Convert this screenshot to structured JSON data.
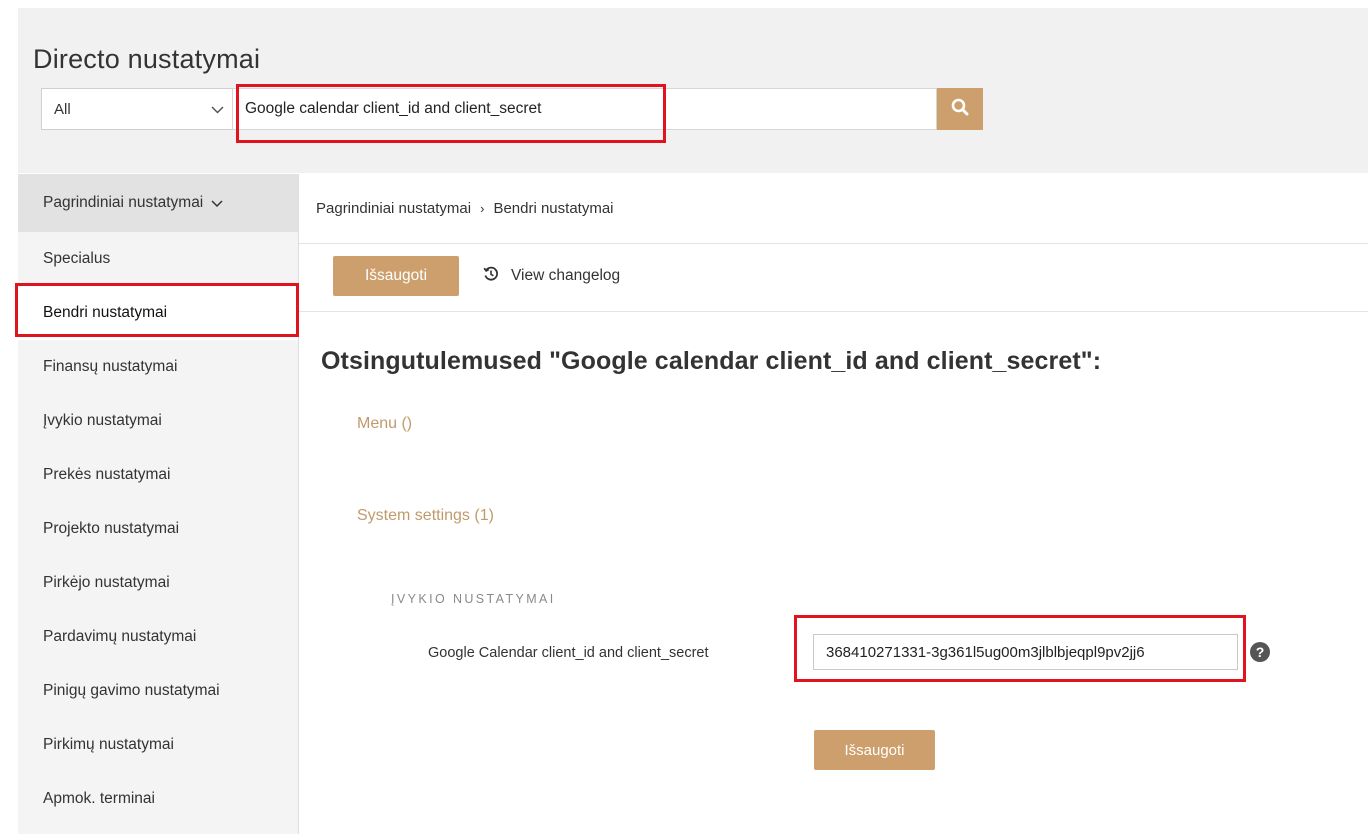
{
  "app": {
    "title": "Directo nustatymai"
  },
  "search": {
    "scope_value": "All",
    "query": "Google calendar client_id and client_secret",
    "button_icon": "search-icon"
  },
  "sidebar": {
    "header_label": "Pagrindiniai nustatymai",
    "items": [
      {
        "label": "Specialus"
      },
      {
        "label": "Bendri nustatymai",
        "active": true
      },
      {
        "label": "Finansų nustatymai"
      },
      {
        "label": "Įvykio nustatymai"
      },
      {
        "label": "Prekės nustatymai"
      },
      {
        "label": "Projekto nustatymai"
      },
      {
        "label": "Pirkėjo nustatymai"
      },
      {
        "label": "Pardavimų nustatymai"
      },
      {
        "label": "Pinigų gavimo nustatymai"
      },
      {
        "label": "Pirkimų nustatymai"
      },
      {
        "label": "Apmok. terminai"
      }
    ]
  },
  "breadcrumb": {
    "parent": "Pagrindiniai nustatymai",
    "separator": "›",
    "current": "Bendri nustatymai"
  },
  "toolbar": {
    "save_label": "Išsaugoti",
    "changelog_label": "View changelog"
  },
  "results": {
    "title": "Otsingutulemused \"Google calendar client_id and client_secret\":",
    "menu_group": "Menu ()",
    "system_group": "System settings (1)",
    "section_label": "ĮVYKIO NUSTATYMAI",
    "field_label": "Google Calendar client_id and client_secret",
    "field_value": "368410271331-3g361l5ug00m3jlblbjeqpl9pv2jj6",
    "save_label": "Išsaugoti"
  },
  "colors": {
    "accent": "#cc9f6d",
    "link": "#c19a6c",
    "highlight": "#e0141e"
  }
}
